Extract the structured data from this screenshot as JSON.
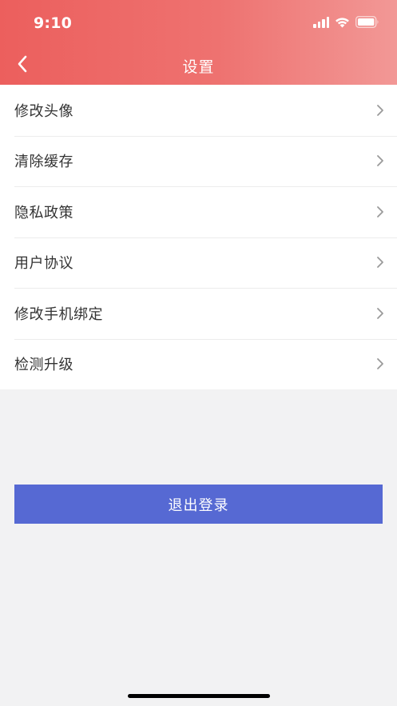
{
  "status_bar": {
    "time": "9:10"
  },
  "nav": {
    "title": "设置"
  },
  "settings": {
    "items": [
      {
        "label": "修改头像"
      },
      {
        "label": "清除缓存"
      },
      {
        "label": "隐私政策"
      },
      {
        "label": "用户协议"
      },
      {
        "label": "修改手机绑定"
      },
      {
        "label": "检测升级"
      }
    ]
  },
  "logout": {
    "label": "退出登录"
  },
  "colors": {
    "header_start": "#ec5f5d",
    "header_end": "#f29896",
    "button": "#5669d3",
    "background": "#f2f2f3"
  },
  "icons": [
    "back-arrow-icon",
    "signal-icon",
    "wifi-icon",
    "battery-icon",
    "chevron-right-icon"
  ]
}
